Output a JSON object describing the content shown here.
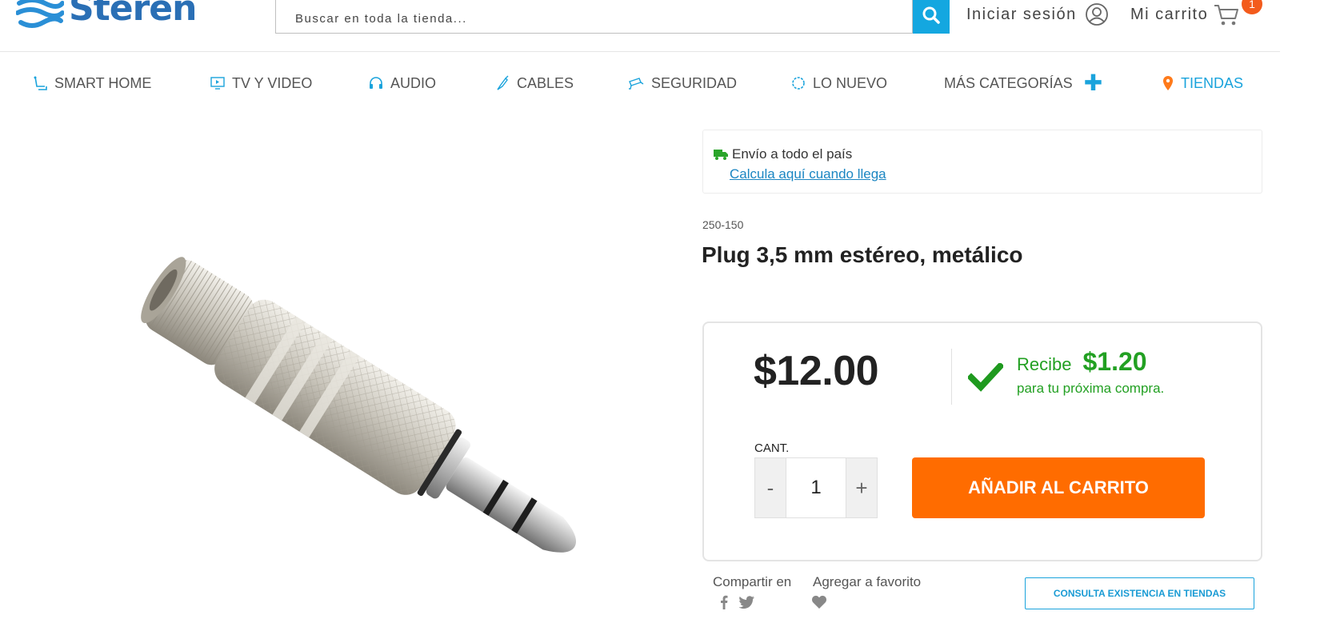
{
  "brand": {
    "name": "Steren"
  },
  "search": {
    "placeholder": "Buscar en toda la tienda..."
  },
  "account": {
    "login_label": "Iniciar sesión",
    "cart_label": "Mi carrito",
    "cart_count": "1"
  },
  "nav": {
    "items": [
      {
        "label": "SMART HOME",
        "icon": "smart-home-icon"
      },
      {
        "label": "TV Y VIDEO",
        "icon": "tv-icon"
      },
      {
        "label": "AUDIO",
        "icon": "headphones-icon"
      },
      {
        "label": "CABLES",
        "icon": "cable-icon"
      },
      {
        "label": "SEGURIDAD",
        "icon": "security-camera-icon"
      },
      {
        "label": "LO NUEVO",
        "icon": "new-badge-icon"
      },
      {
        "label": "MÁS CATEGORÍAS",
        "icon": "plus-icon"
      },
      {
        "label": "TIENDAS",
        "icon": "location-pin-icon"
      }
    ]
  },
  "shipping": {
    "text": "Envío a todo el país",
    "link": "Calcula aquí cuando llega"
  },
  "product": {
    "sku": "250-150",
    "title": "Plug 3,5 mm estéreo, metálico",
    "price": "$12.00",
    "reward_label": "Recibe",
    "reward_amount": "$1.20",
    "reward_sub": "para tu próxima compra.",
    "qty_label": "CANT.",
    "qty_value": "1",
    "qty_minus": "-",
    "qty_plus": "+",
    "add_to_cart": "AÑADIR AL CARRITO"
  },
  "social": {
    "share_label": "Compartir en",
    "favorite_label": "Agregar a favorito",
    "stock_button": "CONSULTA EXISTENCIA EN TIENDAS"
  },
  "colors": {
    "accent_blue": "#14a7e0",
    "orange": "#ff6c00",
    "reward_green": "#22a022",
    "badge": "#f35b1c"
  }
}
